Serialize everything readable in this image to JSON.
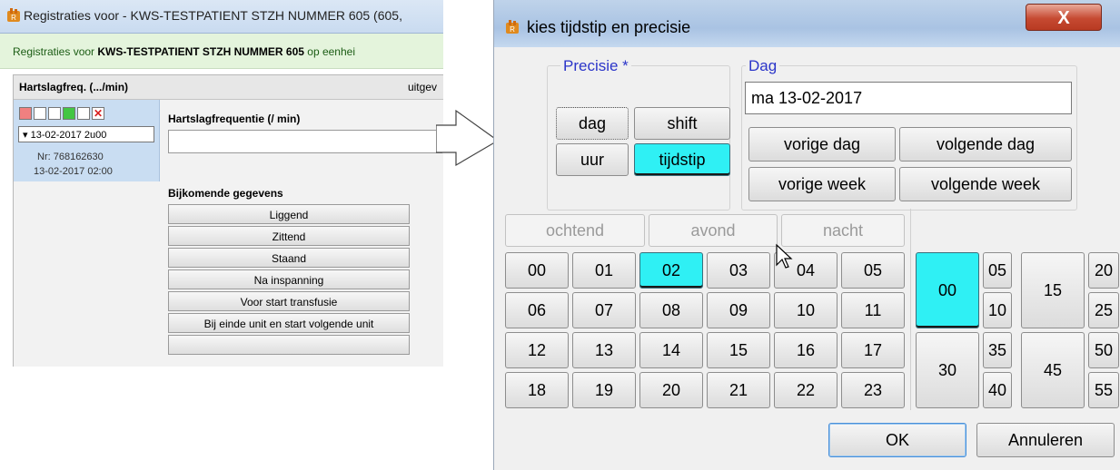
{
  "background_window": {
    "title": "Registraties voor - KWS-TESTPATIENT STZH NUMMER 605  (605,",
    "subheader_prefix": "Registraties voor ",
    "subheader_patient": "KWS-TESTPATIENT STZH NUMMER 605",
    "subheader_suffix": " op eenhei",
    "panel_title": "Hartslagfreq. (.../min)",
    "panel_right": "uitgev",
    "date_selector": "▾ 13-02-2017 2u00",
    "nr": "Nr: 768162630",
    "timestamp": "13-02-2017 02:00",
    "field_label": "Hartslagfrequentie (/ min)",
    "extra_title": "Bijkomende gegevens",
    "extra_buttons": [
      "Liggend",
      "Zittend",
      "Staand",
      "Na inspanning",
      "Voor start transfusie",
      "Bij einde unit en start volgende unit"
    ]
  },
  "dialog": {
    "title": "kies tijdstip en precisie",
    "close_label": "X",
    "precision": {
      "title": "Precisie *",
      "options": [
        "dag",
        "shift",
        "uur",
        "tijdstip"
      ],
      "selected": "tijdstip"
    },
    "day": {
      "title": "Dag",
      "value": "ma 13-02-2017",
      "buttons": [
        "vorige dag",
        "volgende dag",
        "vorige week",
        "volgende week"
      ]
    },
    "shifts": [
      "ochtend",
      "avond",
      "nacht"
    ],
    "hours": [
      "00",
      "01",
      "02",
      "03",
      "04",
      "05",
      "06",
      "07",
      "08",
      "09",
      "10",
      "11",
      "12",
      "13",
      "14",
      "15",
      "16",
      "17",
      "18",
      "19",
      "20",
      "21",
      "22",
      "23"
    ],
    "selected_hour": "02",
    "minutes_big": [
      "00",
      "15",
      "30",
      "45"
    ],
    "minutes_small": [
      "05",
      "10",
      "20",
      "25",
      "35",
      "40",
      "50",
      "55"
    ],
    "selected_minute": "00",
    "ok_label": "OK",
    "cancel_label": "Annuleren"
  },
  "colors": {
    "selected": "#2ff0f4",
    "group_title": "#2b35c9",
    "close_red": "#c64a32"
  }
}
